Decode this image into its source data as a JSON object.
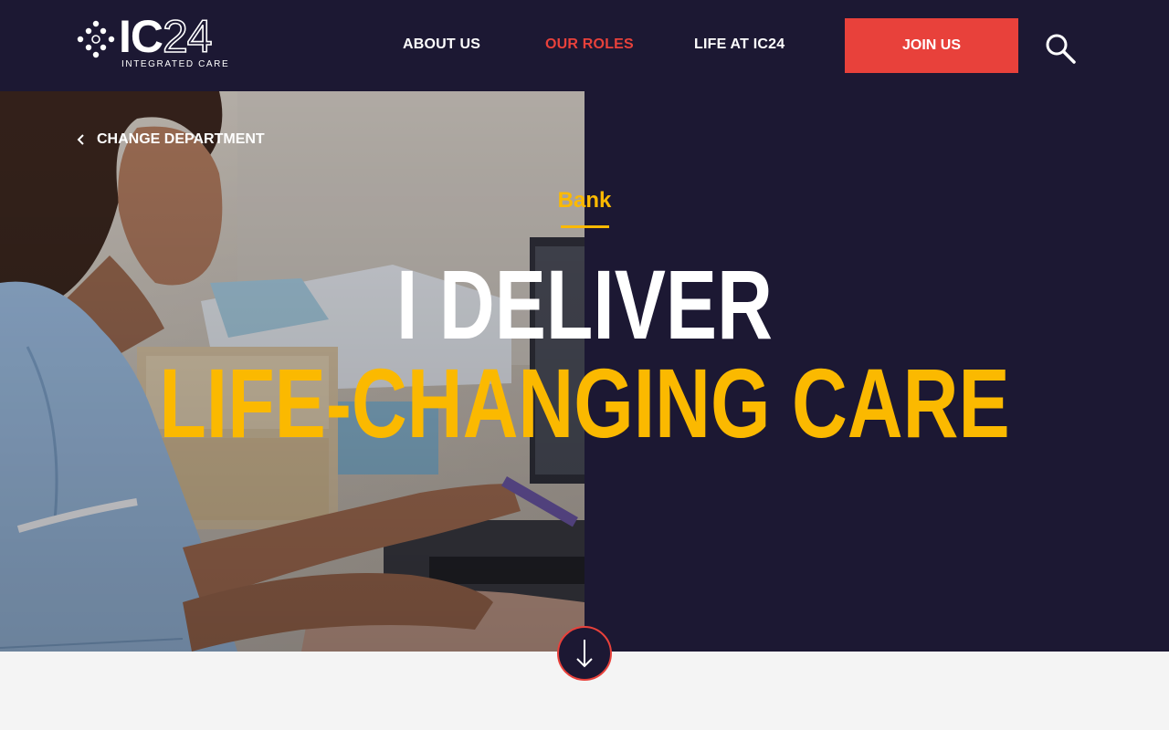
{
  "logo": {
    "main": "IC",
    "number": "24",
    "sub": "INTEGRATED CARE"
  },
  "nav": {
    "about": "ABOUT US",
    "roles": "OUR ROLES",
    "life": "LIFE AT IC24",
    "join": "JOIN US"
  },
  "hero": {
    "back_link": "CHANGE DEPARTMENT",
    "department": "Bank",
    "headline_line1": "I DELIVER",
    "headline_line2": "LIFE-CHANGING CARE"
  },
  "colors": {
    "navy": "#1c1833",
    "accent_red": "#e8413b",
    "accent_yellow": "#fbb900"
  },
  "icons": [
    "logo-dots-icon",
    "search-icon",
    "chevron-left-icon",
    "arrow-down-icon"
  ]
}
